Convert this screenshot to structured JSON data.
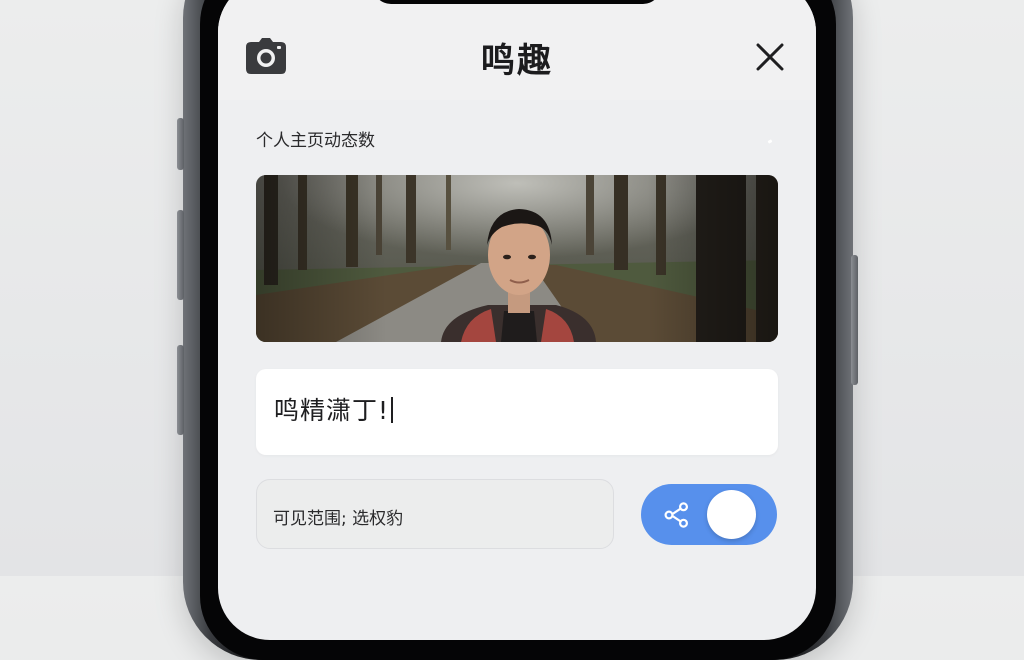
{
  "header": {
    "title": "鸣趣",
    "camera_icon": "camera-icon",
    "close_icon": "close-icon"
  },
  "section": {
    "label": "个人主页动态数"
  },
  "cover": {
    "description_icon": "profile-photo"
  },
  "message": {
    "text": "鸣精潇丁!"
  },
  "visibility": {
    "label": "可见范围; 选权豹"
  },
  "share_toggle": {
    "icon": "share-icon",
    "state": "on",
    "color": "#5790ec"
  },
  "colors": {
    "accent": "#5790ec",
    "screen_bg": "#eeeff1",
    "card_bg": "#ffffff"
  }
}
